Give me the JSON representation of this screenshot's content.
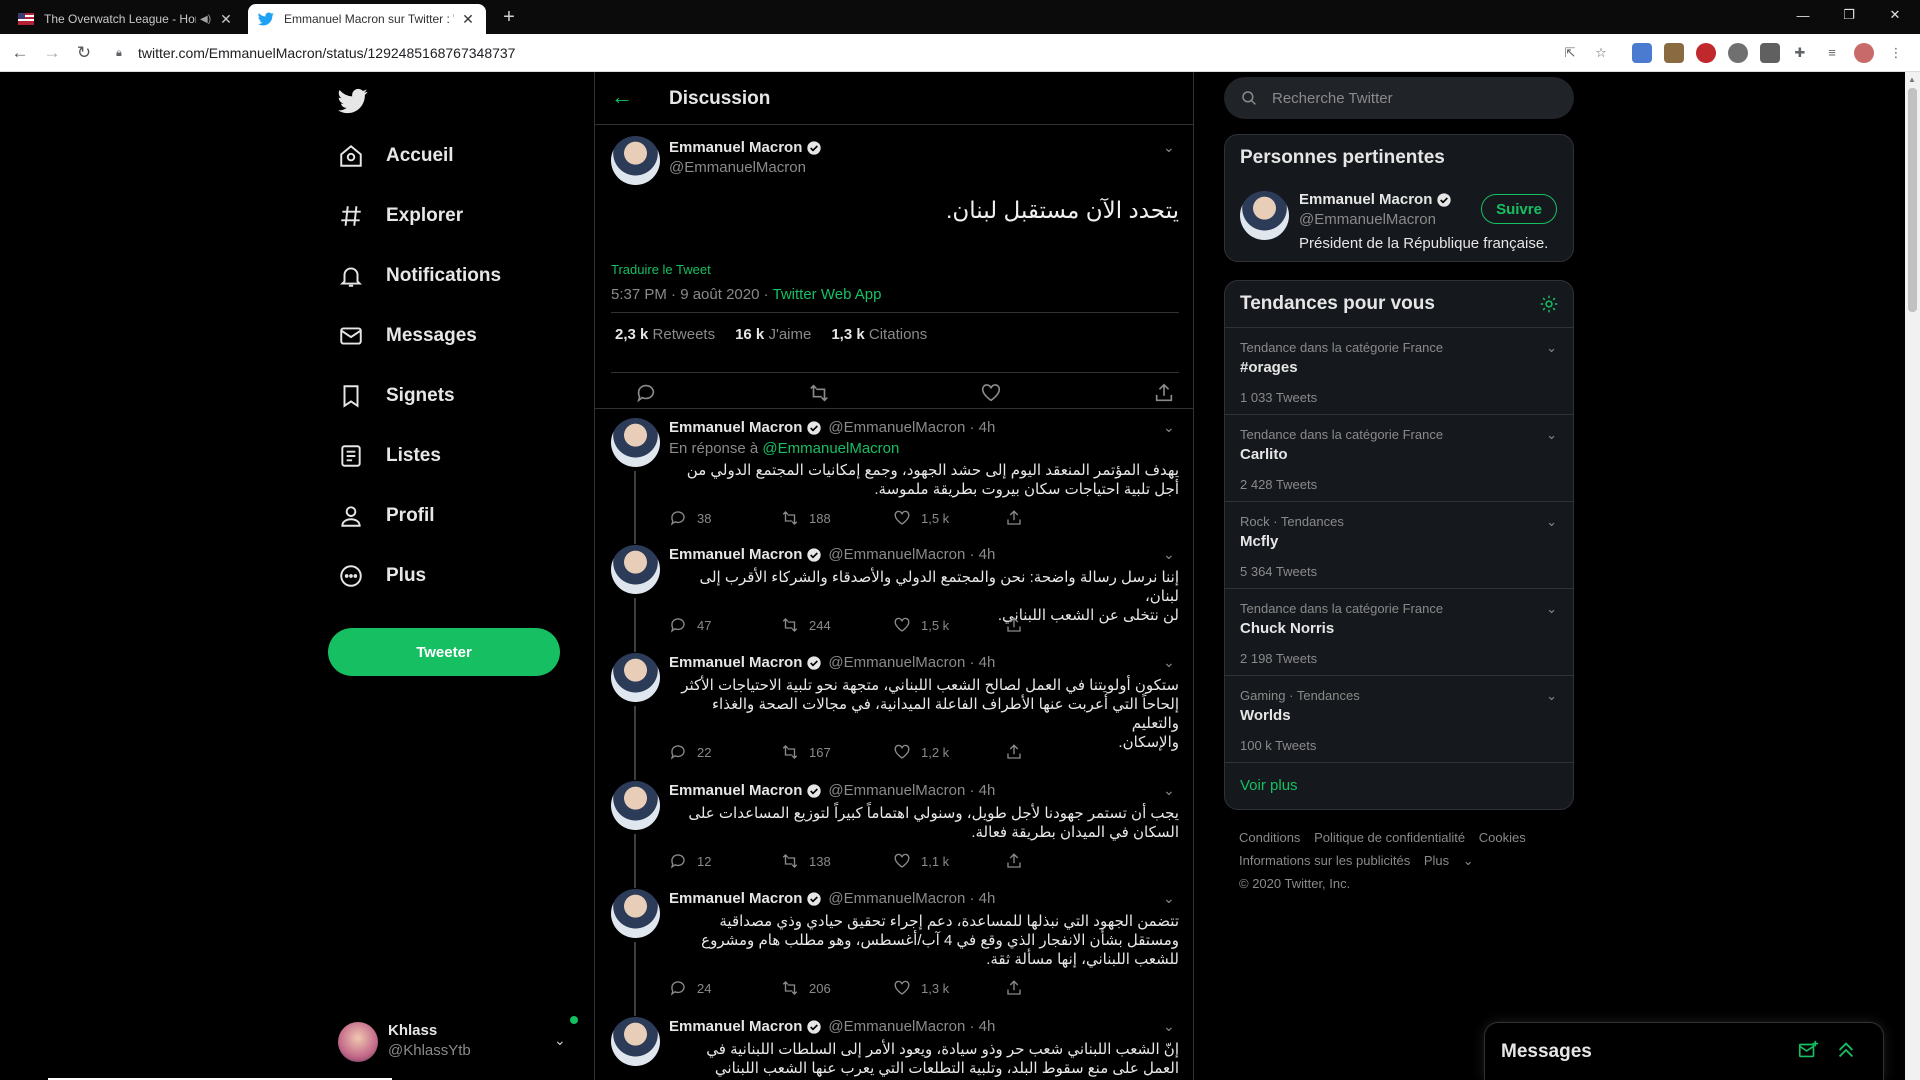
{
  "browser": {
    "tabs": [
      {
        "title": "The Overwatch League - Home",
        "active": false
      },
      {
        "title": "Emmanuel Macron sur Twitter : \"",
        "active": true
      }
    ],
    "url": "twitter.com/EmmanuelMacron/status/1292485168767348737"
  },
  "nav": {
    "items": [
      {
        "label": "Accueil",
        "icon": "home-icon"
      },
      {
        "label": "Explorer",
        "icon": "hashtag-icon"
      },
      {
        "label": "Notifications",
        "icon": "bell-icon"
      },
      {
        "label": "Messages",
        "icon": "envelope-icon"
      },
      {
        "label": "Signets",
        "icon": "bookmark-icon"
      },
      {
        "label": "Listes",
        "icon": "list-icon"
      },
      {
        "label": "Profil",
        "icon": "person-icon"
      },
      {
        "label": "Plus",
        "icon": "more-circle-icon"
      }
    ],
    "tweet_button": "Tweeter",
    "account": {
      "name": "Khlass",
      "handle": "@KhlassYtb"
    }
  },
  "header": {
    "title": "Discussion"
  },
  "main_tweet": {
    "name": "Emmanuel Macron",
    "handle": "@EmmanuelMacron",
    "text": "يتحدد الآن مستقبل لبنان.",
    "translate": "Traduire le Tweet",
    "time": "5:37 PM · 9 août 2020 · ",
    "source": "Twitter Web App",
    "retweets_num": "2,3 k",
    "retweets_label": "Retweets",
    "likes_num": "16 k",
    "likes_label": "J'aime",
    "quotes_num": "1,3 k",
    "quotes_label": "Citations"
  },
  "replies": [
    {
      "name": "Emmanuel Macron",
      "handle": "@EmmanuelMacron · 4h",
      "in_reply_prefix": "En réponse à ",
      "in_reply_to": "@EmmanuelMacron",
      "lines": [
        "يهدف المؤتمر المنعقد اليوم إلى حشد الجهود، وجمع إمكانيات المجتمع الدولي من",
        "أجل تلبية احتياجات سكان بيروت بطريقة ملموسة."
      ],
      "replies": "38",
      "retweets": "188",
      "likes": "1,5 k"
    },
    {
      "name": "Emmanuel Macron",
      "handle": "@EmmanuelMacron · 4h",
      "lines": [
        "إننا نرسل رسالة واضحة: نحن والمجتمع الدولي والأصدقاء والشركاء الأقرب إلى لبنان،",
        "لن نتخلى عن الشعب اللبناني."
      ],
      "replies": "47",
      "retweets": "244",
      "likes": "1,5 k"
    },
    {
      "name": "Emmanuel Macron",
      "handle": "@EmmanuelMacron · 4h",
      "lines": [
        "ستكون أولويتنا في العمل لصالح الشعب اللبناني، متجهة نحو تلبية الاحتياجات الأكثر",
        "إلحاحاً التي أعربت عنها الأطراف الفاعلة الميدانية، في مجالات الصحة والغذاء والتعليم",
        "والإسكان."
      ],
      "replies": "22",
      "retweets": "167",
      "likes": "1,2 k"
    },
    {
      "name": "Emmanuel Macron",
      "handle": "@EmmanuelMacron · 4h",
      "lines": [
        "يجب أن تستمر جهودنا لأجل طويل، وسنولي اهتماماً كبيراً لتوزيع المساعدات على",
        "السكان في الميدان بطريقة فعالة."
      ],
      "replies": "12",
      "retweets": "138",
      "likes": "1,1 k"
    },
    {
      "name": "Emmanuel Macron",
      "handle": "@EmmanuelMacron · 4h",
      "lines": [
        "تتضمن الجهود التي نبذلها للمساعدة، دعم إجراء تحقيق حيادي وذي مصداقية",
        "ومستقل بشأن الانفجار الذي وقع في 4 آب/أغسطس، وهو مطلب هام ومشروع",
        "للشعب اللبناني، إنها مسألة ثقة."
      ],
      "replies": "24",
      "retweets": "206",
      "likes": "1,3 k"
    },
    {
      "name": "Emmanuel Macron",
      "handle": "@EmmanuelMacron · 4h",
      "lines": [
        "إنّ الشعب اللبناني شعب حر وذو سيادة، ويعود الأمر إلى السلطات اللبنانية في",
        "العمل على منع سقوط البلد، وتلبية التطلعات التي يعرب عنها الشعب اللبناني"
      ],
      "replies": "",
      "retweets": "",
      "likes": ""
    }
  ],
  "search": {
    "placeholder": "Recherche Twitter"
  },
  "relevant": {
    "title": "Personnes pertinentes",
    "name": "Emmanuel Macron",
    "handle": "@EmmanuelMacron",
    "bio": "Président de la République française.",
    "follow": "Suivre"
  },
  "trends": {
    "title": "Tendances pour vous",
    "items": [
      {
        "category": "Tendance dans la catégorie France",
        "name": "#orages",
        "count": "1 033 Tweets"
      },
      {
        "category": "Tendance dans la catégorie France",
        "name": "Carlito",
        "count": "2 428 Tweets"
      },
      {
        "category": "Rock · Tendances",
        "name": "Mcfly",
        "count": "5 364 Tweets"
      },
      {
        "category": "Tendance dans la catégorie France",
        "name": "Chuck Norris",
        "count": "2 198 Tweets"
      },
      {
        "category": "Gaming · Tendances",
        "name": "Worlds",
        "count": "100 k Tweets"
      }
    ],
    "more": "Voir plus"
  },
  "footer": {
    "links": [
      "Conditions",
      "Politique de confidentialité",
      "Cookies",
      "Informations sur les publicités",
      "Plus"
    ],
    "copyright": "© 2020 Twitter, Inc."
  },
  "dm_drawer": {
    "title": "Messages"
  },
  "colors": {
    "accent": "#17bf63",
    "background": "#000000",
    "panel": "#15181c"
  }
}
